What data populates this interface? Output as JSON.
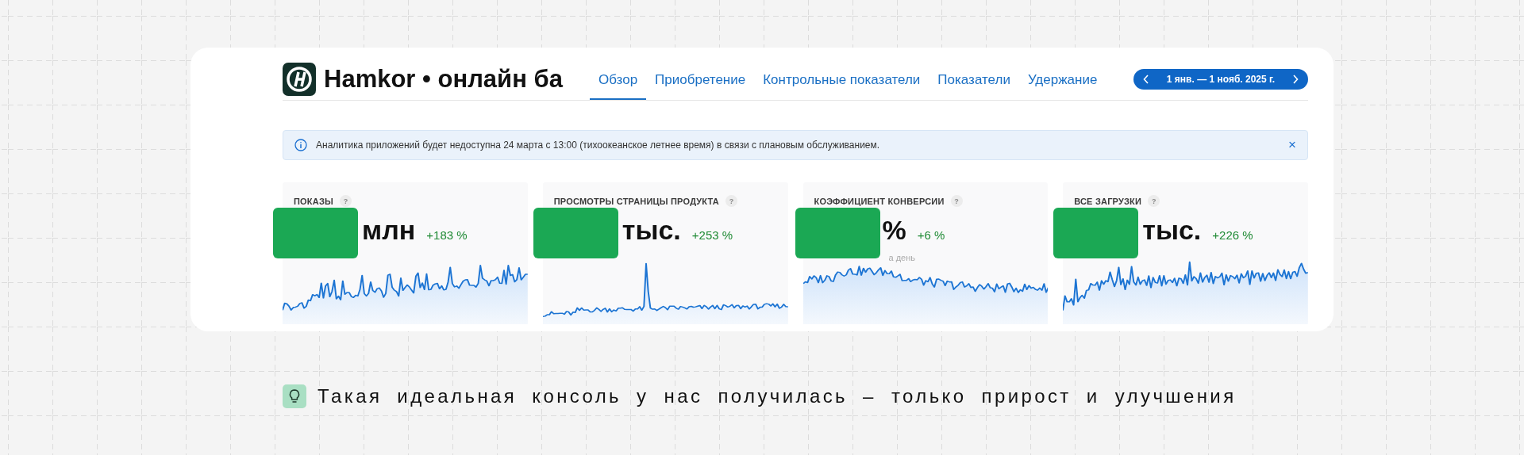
{
  "header": {
    "title": "Hamkor • онлайн ба"
  },
  "tabs": [
    {
      "label": "Обзор",
      "selected": true
    },
    {
      "label": "Приобретение",
      "selected": false
    },
    {
      "label": "Контрольные показатели",
      "selected": false
    },
    {
      "label": "Показатели",
      "selected": false
    },
    {
      "label": "Удержание",
      "selected": false
    }
  ],
  "date_range": {
    "label": "1 янв. — 1 нояб. 2025 г."
  },
  "banner": {
    "text": "Аналитика приложений будет недоступна 24 марта с 13:00 (тихоокеанское летнее время) в связи с плановым обслуживанием.",
    "close": "×"
  },
  "metrics": [
    {
      "title": "ПОКАЗЫ",
      "help": "?",
      "unit": "млн",
      "change": "+183 %"
    },
    {
      "title": "ПРОСМОТРЫ СТРАНИЦЫ ПРОДУКТА",
      "help": "?",
      "unit": "тыс.",
      "change": "+253 %"
    },
    {
      "title": "КОЭФФИЦИЕНТ КОНВЕРСИИ",
      "help": "?",
      "unit": "%",
      "change": "+6 %",
      "note": "а день"
    },
    {
      "title": "ВСЕ ЗАГРУЗКИ",
      "help": "?",
      "unit": "тыс.",
      "change": "+226 %"
    }
  ],
  "tip": {
    "text": "Такая идеальная консоль у нас получилась – только прирост и улучшения"
  }
}
